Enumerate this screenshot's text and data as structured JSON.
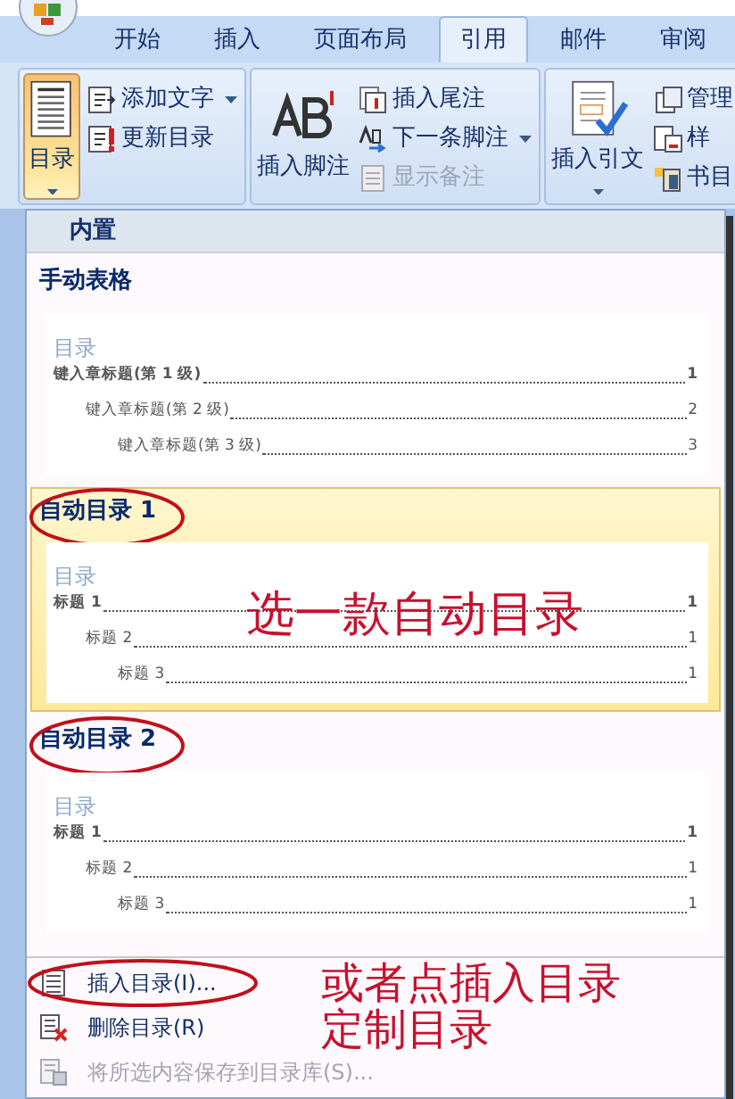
{
  "tabs": [
    {
      "label": "开始",
      "selected": false
    },
    {
      "label": "插入",
      "selected": false
    },
    {
      "label": "页面布局",
      "selected": false
    },
    {
      "label": "引用",
      "selected": true
    },
    {
      "label": "邮件",
      "selected": false
    },
    {
      "label": "审阅",
      "selected": false
    }
  ],
  "ribbon": {
    "groups": [
      {
        "large": {
          "label": "目录",
          "kind": "toc",
          "pressed": true,
          "dropdown": true
        },
        "small": [
          {
            "label": "添加文字",
            "kind": "add-text",
            "dropdown": true,
            "disabled": false
          },
          {
            "label": "更新目录",
            "kind": "update",
            "dropdown": false,
            "disabled": false
          }
        ]
      },
      {
        "large": {
          "label": "插入脚注",
          "kind": "footnote",
          "pressed": false,
          "dropdown": false
        },
        "small": [
          {
            "label": "插入尾注",
            "kind": "endnote",
            "dropdown": false,
            "disabled": false
          },
          {
            "label": "下一条脚注",
            "kind": "next",
            "dropdown": true,
            "disabled": false
          },
          {
            "label": "显示备注",
            "kind": "notes",
            "dropdown": false,
            "disabled": true
          }
        ]
      },
      {
        "large": {
          "label": "插入引文",
          "kind": "citation",
          "pressed": false,
          "dropdown": true
        },
        "small": [
          {
            "label": "管理",
            "kind": "manage",
            "dropdown": false,
            "disabled": false
          },
          {
            "label": "样",
            "kind": "style",
            "dropdown": false,
            "disabled": false
          },
          {
            "label": "书目",
            "kind": "bibliography",
            "dropdown": false,
            "disabled": false
          }
        ]
      }
    ]
  },
  "toc_menu": {
    "header": "内置",
    "items": [
      {
        "title": "手动表格",
        "selected": false,
        "circled": false,
        "preview": {
          "title": "目录",
          "entries": [
            {
              "text": "键入章标题(第 1 级)",
              "page": "1",
              "children": [
                {
                  "text": "键入章标题(第 2 级)",
                  "page": "2",
                  "children": [
                    {
                      "text": "键入章标题(第 3 级)",
                      "page": "3"
                    }
                  ]
                }
              ]
            }
          ]
        }
      },
      {
        "title": "自动目录 1",
        "selected": true,
        "circled": true,
        "annotation": "选一款自动目录",
        "preview": {
          "title": "目录",
          "entries": [
            {
              "text": "标题 1",
              "page": "1",
              "children": [
                {
                  "text": "标题 2",
                  "page": "1",
                  "children": [
                    {
                      "text": "标题 3",
                      "page": "1"
                    }
                  ]
                }
              ]
            }
          ]
        }
      },
      {
        "title": "自动目录 2",
        "selected": false,
        "circled": true,
        "preview": {
          "title": "目录",
          "entries": [
            {
              "text": "标题 1",
              "page": "1",
              "children": [
                {
                  "text": "标题 2",
                  "page": "1",
                  "children": [
                    {
                      "text": "标题 3",
                      "page": "1"
                    }
                  ]
                }
              ]
            }
          ]
        }
      }
    ],
    "commands": [
      {
        "label": "插入目录(I)...",
        "kind": "insert",
        "disabled": false,
        "circled": true
      },
      {
        "label": "删除目录(R)",
        "kind": "remove",
        "disabled": false,
        "circled": false
      },
      {
        "label": "将所选内容保存到目录库(S)...",
        "kind": "save",
        "disabled": true,
        "circled": false
      }
    ],
    "note": [
      "或者点插入目录",
      "定制目录"
    ]
  }
}
